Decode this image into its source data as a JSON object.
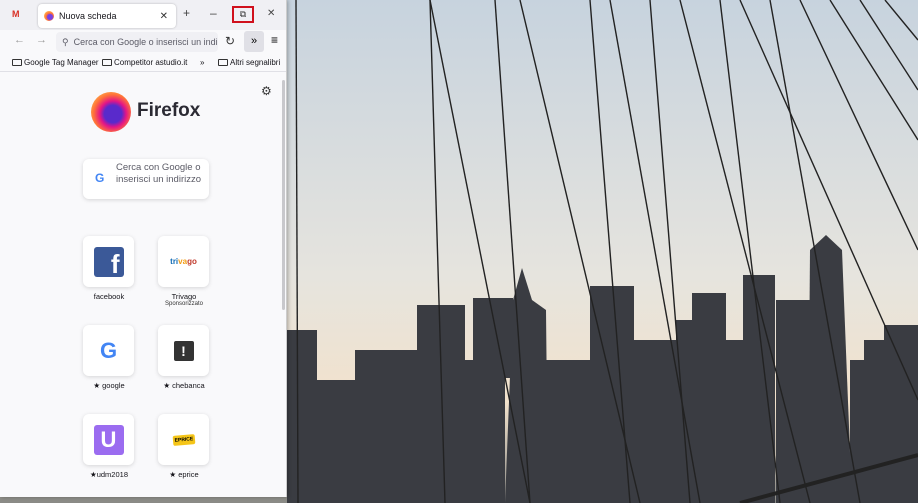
{
  "browser": {
    "tab_title": "Nuova scheda",
    "url_placeholder": "Cerca con Google o inserisci un indirizzo",
    "bookmarks": [
      "Google Tag Manager",
      "Competitor astudio.it",
      "Altri segnalibri"
    ],
    "brand": "Firefox",
    "search_placeholder": "Cerca con Google o inserisci un indirizzo",
    "shortcuts": [
      {
        "label": "facebook",
        "sub": ""
      },
      {
        "label": "Trivago",
        "sub": "Sponsorizzato"
      },
      {
        "label": "google",
        "sub": ""
      },
      {
        "label": "chebanca",
        "sub": ""
      },
      {
        "label": "udm2018",
        "sub": ""
      },
      {
        "label": "eprice",
        "sub": ""
      }
    ]
  },
  "colors": {
    "highlight": "#d0101c",
    "accent": "#7542e5"
  }
}
